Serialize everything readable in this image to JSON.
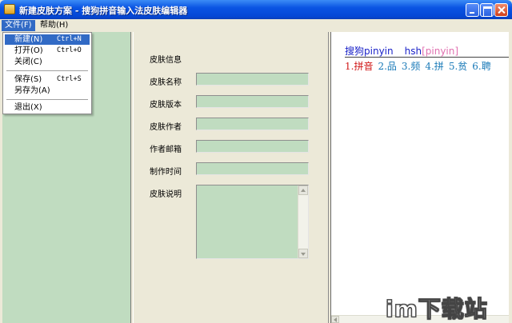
{
  "window": {
    "title": "新建皮肤方案 - 搜狗拼音输入法皮肤编辑器"
  },
  "menubar": {
    "file": "文件(F)",
    "help": "帮助(H)"
  },
  "file_menu": {
    "items": [
      {
        "label": "新建(N)",
        "shortcut": "Ctrl+N"
      },
      {
        "label": "打开(O)",
        "shortcut": "Ctrl+O"
      },
      {
        "label": "关闭(C)",
        "shortcut": ""
      },
      {
        "label": "保存(S)",
        "shortcut": "Ctrl+S"
      },
      {
        "label": "另存为(A)",
        "shortcut": ""
      },
      {
        "label": "退出(X)",
        "shortcut": ""
      }
    ]
  },
  "skin_form": {
    "section_title": "皮肤信息",
    "fields": [
      {
        "label": "皮肤名称",
        "value": ""
      },
      {
        "label": "皮肤版本",
        "value": ""
      },
      {
        "label": "皮肤作者",
        "value": ""
      },
      {
        "label": "作者邮箱",
        "value": ""
      },
      {
        "label": "制作时间",
        "value": ""
      }
    ],
    "description_label": "皮肤说明",
    "description_value": ""
  },
  "preview": {
    "brand": "搜狗",
    "pinyin": "pinyin",
    "code": "hsh",
    "code_hint": "[pinyin]",
    "candidates": [
      "1.拼音",
      "2.品",
      "3.频",
      "4.拼",
      "5.贫",
      "6.聘"
    ]
  },
  "watermark": "im下载站",
  "colors": {
    "accent": "#316ac5",
    "panel_green": "#c0dcc0",
    "candidate_first": "#d01818",
    "candidate": "#1a7ab8",
    "preview_text": "#1a22c8",
    "code_hint": "#e070b0"
  }
}
